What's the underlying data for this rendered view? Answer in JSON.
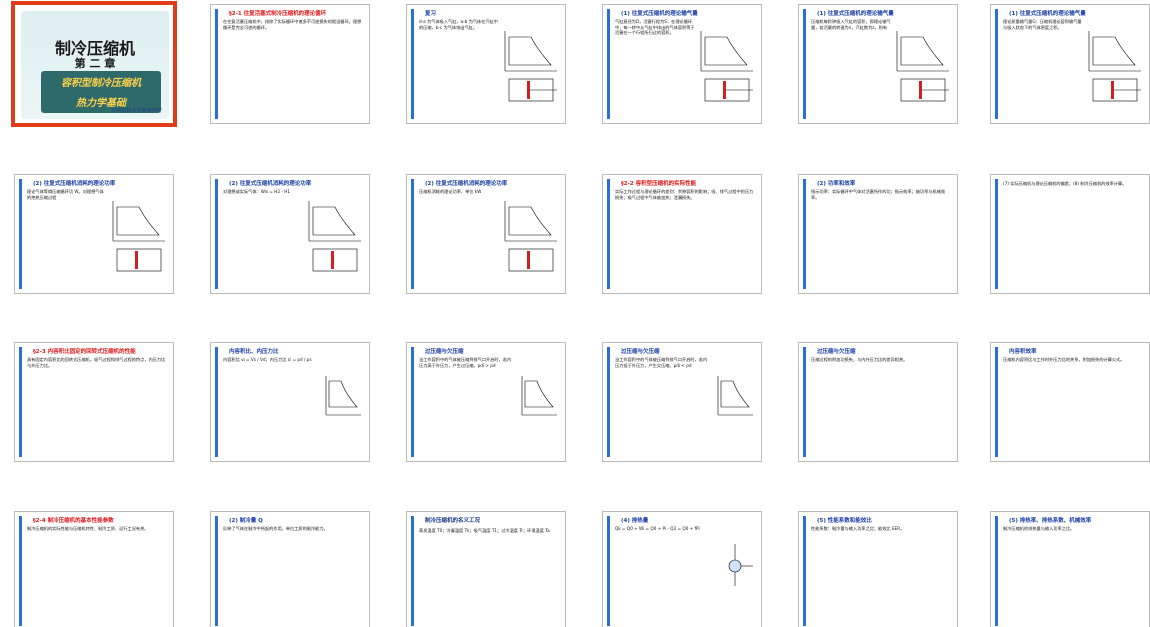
{
  "cover": {
    "title": "制冷压缩机",
    "chapter": "第 二 章",
    "subtitle_line1": "容积型制冷压缩机",
    "subtitle_line2": "热力学基础",
    "logo": "华中科技大学能源学院"
  },
  "slides": [
    {
      "title": "§2-1 往复活塞式制冷压缩机的理论循环",
      "title_color": "red",
      "text": "在往复活塞压缩机中，排除了实际循环中诸多不可逆损失的假设循环。理想循环是完全可逆的循环。"
    },
    {
      "title": "复习",
      "title_color": "blue",
      "text": "d-a 为气体吸入气缸，a-b 为气体在汽缸中的压缩，b-c 为气体排出气缸。"
    },
    {
      "title": "(1) 往复式压缩机的理论输气量",
      "title_color": "blue",
      "text": "气缸直径为D，活塞行程为S，在理论循环中，每一转中从气缸中排出的气体容积等于活塞在一个行程所扫过的容积。"
    },
    {
      "title": "(1) 往复式压缩机的理论输气量",
      "title_color": "blue",
      "text": "压缩机每秒钟吸入气缸的容积，即理论输气量，若活塞的转速为n，汽缸数为z，则有"
    },
    {
      "title": "(1) 往复式压缩机的理论输气量",
      "title_color": "blue",
      "text": "理论质量输气量G：压缩机理论容积输气量与吸入状态下的气体密度之积。"
    },
    {
      "title": "(2) 往复式压缩机消耗的理论功率",
      "title_color": "blue",
      "text": "理论气体等熵压缩循环功 W。对理想气体的绝热压缩过程"
    },
    {
      "title": "(2) 往复式压缩机消耗的理论功率",
      "title_color": "blue",
      "text": "对理想或实际气体：Wis = H2 - H1"
    },
    {
      "title": "(2) 往复式压缩机消耗的理论功率",
      "title_color": "blue",
      "text": "压缩机消耗的理论功率，单位 kW"
    },
    {
      "title": "§2-2 容积型压缩机的实际性能",
      "title_color": "red",
      "text": "实际工作过程与理论循环的差别：余隙容积的影响；吸、排气过程中的压力损失；吸气过程中气体被加热；泄漏损失。"
    },
    {
      "title": "(2) 功率和效率",
      "title_color": "blue",
      "text": "指示功率：实际循环中气体对活塞所作的功；指示效率；轴功率与机械效率。"
    },
    {
      "title": "",
      "title_color": "blue",
      "text": "(7) 实际压缩机与理论压缩机的偏差；(8) 制冷压缩机的效率计算。"
    },
    {
      "title": "§2-3 内容积比固定的回转式压缩机的性能",
      "title_color": "red",
      "text": "具有固定内容积比的回转式压缩机，吸气过程和排气过程的特点，内压力比与外压力比。"
    },
    {
      "title": "内容积比、内压力比",
      "title_color": "blue",
      "text": "内容积比 vi = Vs / Vd；内压力比 εi = pd / ps"
    },
    {
      "title": "过压缩与欠压缩",
      "title_color": "blue",
      "text": "当工作容积中的气体被压缩到排气口开启时，若内压力高于外压力，产生过压缩。pdi > pd"
    },
    {
      "title": "过压缩与欠压缩",
      "title_color": "blue",
      "text": "当工作容积中的气体被压缩到排气口开启时，若内压力低于外压力，产生欠压缩。pdi < pd"
    },
    {
      "title": "过压缩与欠压缩",
      "title_color": "blue",
      "text": "压缩过程的附加功损失，与内外压力比的差异相关。"
    },
    {
      "title": "内容积效率",
      "title_color": "blue",
      "text": "压缩机内容积比与工作时外压力比的关系，附加损失的计算公式。"
    },
    {
      "title": "§2-4 制冷压缩机的基本性能参数",
      "title_color": "red",
      "text": "制冷压缩机的实际性能与压缩机特性、制冷工质、运行工况有关。"
    },
    {
      "title": "(2) 制冷量 Q",
      "title_color": "blue",
      "text": "反映了气体在制冷中所起的作用，单位工质的制冷能力。"
    },
    {
      "title": "制冷压缩机的名义工况",
      "title_color": "dark",
      "text": "蒸发温度 T0；冷凝温度 Tk；吸气温度 T1；过冷温度 Tr；环境温度 Ta"
    },
    {
      "title": "(4) 排热量",
      "title_color": "blue",
      "text": "Qk = Q0 + Wi = Q0 + Pi - Q2 = Q0 + fPi"
    },
    {
      "title": "(5) 性能系数和能效比",
      "title_color": "blue",
      "text": "性能系数：制冷量与输入功率之比；能效比 EER。"
    },
    {
      "title": "(5) 排热率、排热系数、机械效率",
      "title_color": "blue",
      "text": "制冷压缩机的排热量与输入功率之比。"
    }
  ]
}
